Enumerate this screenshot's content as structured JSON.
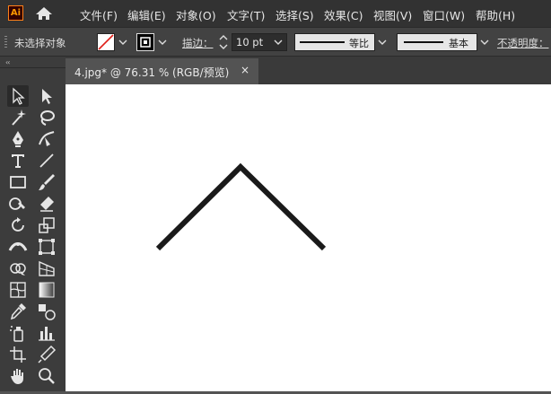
{
  "app": {
    "logo_text": "Ai"
  },
  "menu": [
    "文件(F)",
    "编辑(E)",
    "对象(O)",
    "文字(T)",
    "选择(S)",
    "效果(C)",
    "视图(V)",
    "窗口(W)",
    "帮助(H)"
  ],
  "control_bar": {
    "selection_status": "未选择对象",
    "stroke_label": "描边：",
    "stroke_weight": "10 pt",
    "profile_label": "等比",
    "brush_label": "基本",
    "opacity_label": "不透明度："
  },
  "document_tab": {
    "title": "4.jpg* @ 76.31 % (RGB/预览)",
    "close_glyph": "×"
  },
  "toolbar": {
    "collapse_glyph": "‹‹",
    "tools": [
      [
        "selection-tool-icon",
        "direct-selection-tool-icon"
      ],
      [
        "magic-wand-tool-icon",
        "lasso-tool-icon"
      ],
      [
        "pen-tool-icon",
        "curvature-tool-icon"
      ],
      [
        "type-tool-icon",
        "line-segment-tool-icon"
      ],
      [
        "rectangle-tool-icon",
        "paintbrush-tool-icon"
      ],
      [
        "shaper-tool-icon",
        "eraser-tool-icon"
      ],
      [
        "rotate-tool-icon",
        "scale-tool-icon"
      ],
      [
        "width-tool-icon",
        "free-transform-tool-icon"
      ],
      [
        "shape-builder-tool-icon",
        "perspective-grid-tool-icon"
      ],
      [
        "mesh-tool-icon",
        "gradient-tool-icon"
      ],
      [
        "eyedropper-tool-icon",
        "blend-tool-icon"
      ],
      [
        "symbol-sprayer-tool-icon",
        "column-graph-tool-icon"
      ],
      [
        "artboard-tool-icon",
        "slice-tool-icon"
      ],
      [
        "hand-tool-icon",
        "zoom-tool-icon"
      ]
    ]
  },
  "colors": {
    "menubar": "#323232",
    "control_bar": "#424242",
    "toolbar": "#3c3c3c",
    "canvas": "#ffffff",
    "artwork_stroke": "#1a1a1a",
    "logo_orange": "#ff9a00"
  }
}
